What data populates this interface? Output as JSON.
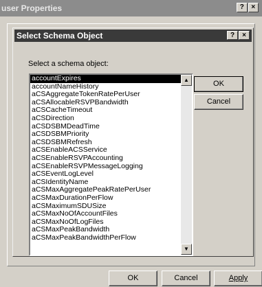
{
  "background_window": {
    "title": "user Properties",
    "help_button": "?",
    "close_button": "×"
  },
  "dialog": {
    "title": "Select Schema Object",
    "help_button": "?",
    "close_button": "×",
    "prompt_label": "Select a schema object:",
    "ok_label": "OK",
    "cancel_label": "Cancel",
    "items": [
      "accountExpires",
      "accountNameHistory",
      "aCSAggregateTokenRatePerUser",
      "aCSAllocableRSVPBandwidth",
      "aCSCacheTimeout",
      "aCSDirection",
      "aCSDSBMDeadTime",
      "aCSDSBMPriority",
      "aCSDSBMRefresh",
      "aCSEnableACSService",
      "aCSEnableRSVPAccounting",
      "aCSEnableRSVPMessageLogging",
      "aCSEventLogLevel",
      "aCSIdentityName",
      "aCSMaxAggregatePeakRatePerUser",
      "aCSMaxDurationPerFlow",
      "aCSMaximumSDUSize",
      "aCSMaxNoOfAccountFiles",
      "aCSMaxNoOfLogFiles",
      "aCSMaxPeakBandwidth",
      "aCSMaxPeakBandwidthPerFlow"
    ],
    "selected_index": 0
  },
  "bottom_buttons": {
    "ok_label": "OK",
    "cancel_label": "Cancel",
    "apply_label": "Apply"
  },
  "icons": {
    "scroll_up": "▲",
    "scroll_down": "▼"
  }
}
